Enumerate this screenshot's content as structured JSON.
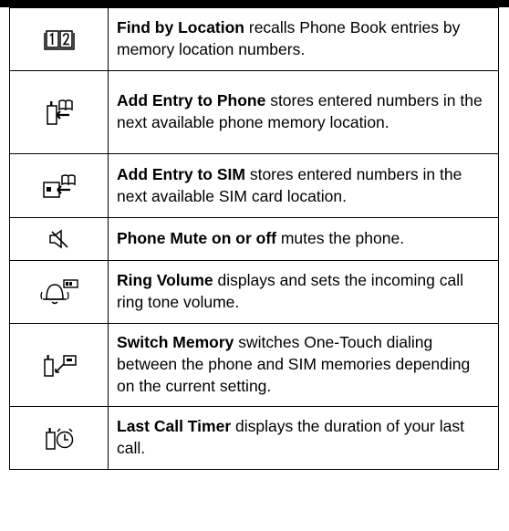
{
  "table": {
    "rows": [
      {
        "icon": "phone-book-location-icon",
        "name": "Find by Location",
        "desc": " recalls Phone Book entries by memory location numbers."
      },
      {
        "icon": "add-entry-to-phone-icon",
        "name": "Add Entry to Phone",
        "desc": " stores entered numbers in the next available phone memory location."
      },
      {
        "icon": "add-entry-to-sim-icon",
        "name": "Add Entry to SIM",
        "desc": " stores entered numbers in the next available SIM card location."
      },
      {
        "icon": "speaker-mute-icon",
        "name": "Phone Mute on or off",
        "desc": " mutes the phone."
      },
      {
        "icon": "ring-volume-icon",
        "name": "Ring Volume",
        "desc": " displays and sets the incoming call ring tone volume."
      },
      {
        "icon": "switch-memory-icon",
        "name": "Switch Memory",
        "desc": " switches One-Touch dialing between the phone and SIM memories depending on the current setting."
      },
      {
        "icon": "call-timer-icon",
        "name": "Last Call Timer",
        "desc": " displays the duration of your last call."
      }
    ]
  }
}
